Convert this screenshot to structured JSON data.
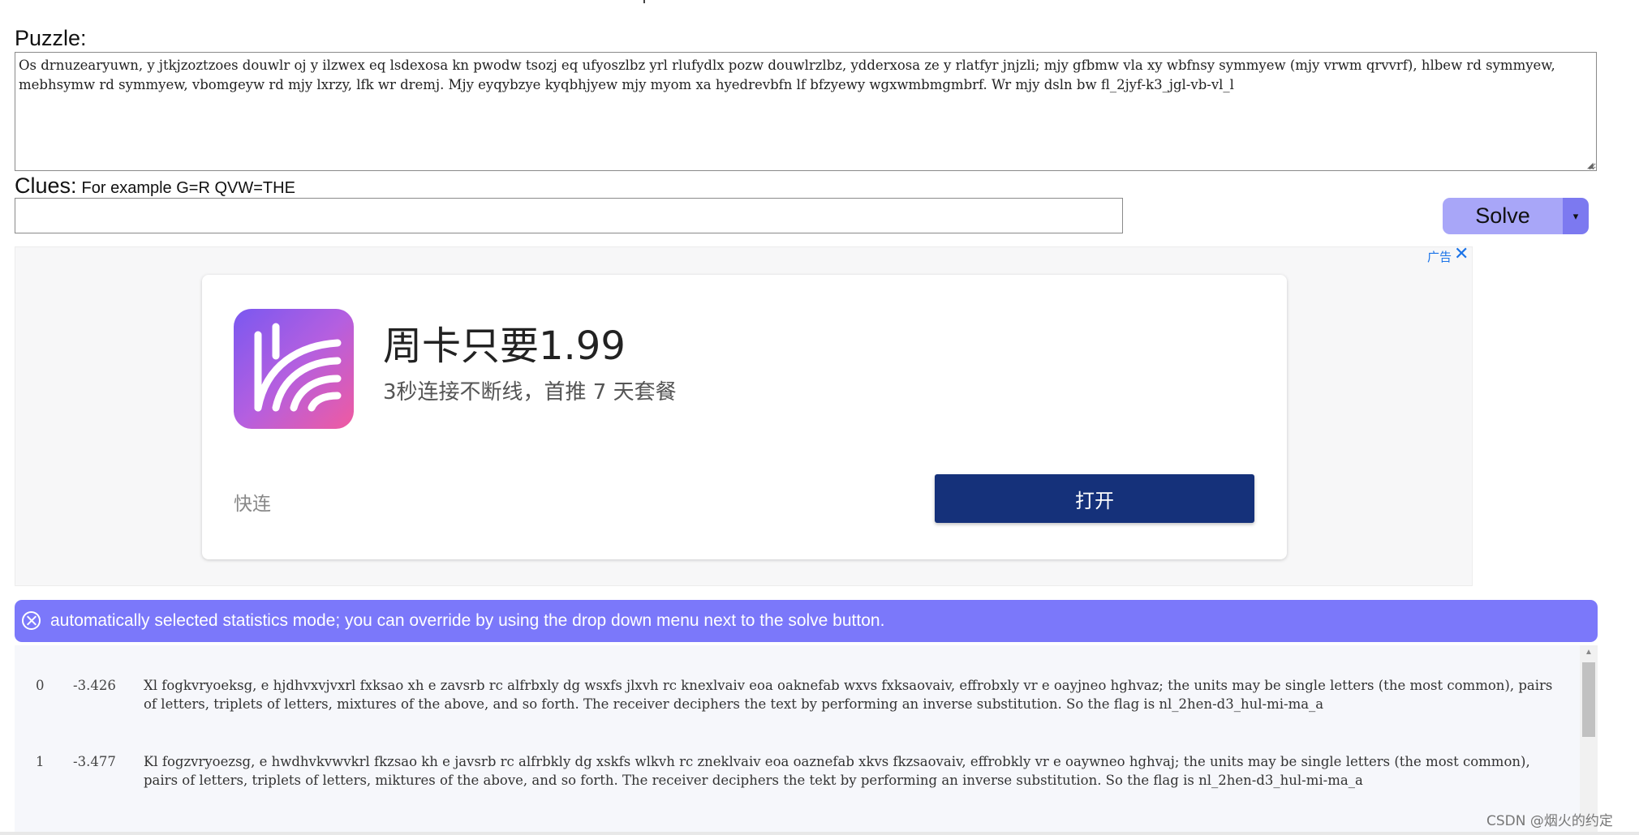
{
  "labels": {
    "puzzle": "Puzzle:",
    "clues": "Clues:",
    "clues_hint": "For example G=R QVW=THE"
  },
  "puzzle": {
    "text": "Os drnuzearyuwn, y jtkjzoztzoes douwlr oj y ilzwex eq lsdexosa kn pwodw tsozj eq ufyoszlbz yrl rlufydlx pozw douwlrzlbz, ydderxosa ze y rlatfyr jnjzli; mjy gfbmw vla xy wbfnsy symmyew (mjy vrwm qrvvrf), hlbew rd symmyew, mebhsymw rd symmyew, vbomgeyw rd mjy lxrzy, lfk wr dremj. Mjy eyqybzye kyqbhjyew mjy myom xa hyedrevbfn lf bfzyewy wgxwmbmgmbrf. Wr mjy dsln bw fl_2jyf-k3_jgl-vb-vl_l"
  },
  "clues": {
    "value": "",
    "placeholder": ""
  },
  "buttons": {
    "solve": "Solve",
    "solve_dropdown": "▾"
  },
  "ad": {
    "badge": "广告",
    "close": "✕",
    "app_name": "周卡只要1.99",
    "app_desc": "3秒连接不断线，首推 7 天套餐",
    "brand": "快连",
    "open_button": "打开"
  },
  "banner": {
    "message": "automatically selected statistics mode; you can override by using the drop down menu next to the solve button."
  },
  "results": [
    {
      "index": "0",
      "score": "-3.426",
      "text": "Xl fogkvryoeksg, e hjdhvxvjvxrl fxksao xh e zavsrb rc alfrbxly dg wsxfs jlxvh rc knexlvaiv eoa oaknefab wxvs fxksaovaiv, effrobxly vr e oayjneo hghvaz; the units may be single letters (the most common), pairs of letters, triplets of letters, mixtures of the above, and so forth. The receiver deciphers the text by performing an inverse substitution. So the flag is nl_2hen-d3_hul-mi-ma_a"
    },
    {
      "index": "1",
      "score": "-3.477",
      "text": "Kl fogzvryoezsg, e hwdhvkvwvkrl fkzsao kh e javsrb rc alfrbkly dg xskfs wlkvh rc zneklvaiv eoa oaznefab xkvs fkzsaovaiv, effrobkly vr e oaywneo hghvaj; the units may be single letters (the most common), pairs of letters, triplets of letters, miktures of the above, and so forth. The receiver deciphers the tekt by performing an inverse substitution. So the flag is nl_2hen-d3_hul-mi-ma_a"
    }
  ],
  "watermark": "CSDN @烟火的约定",
  "colors": {
    "solve_button": "#a8a6f8",
    "solve_dropdown": "#7c79f0",
    "banner": "#7b78fa",
    "open_button": "#15317a",
    "ad_link": "#1a73e8"
  },
  "icons": {
    "banner_close": "circle-x-icon",
    "app": "kuailian-app-icon",
    "ad_close": "close-icon",
    "scroll_up": "scroll-up-arrow-icon"
  }
}
